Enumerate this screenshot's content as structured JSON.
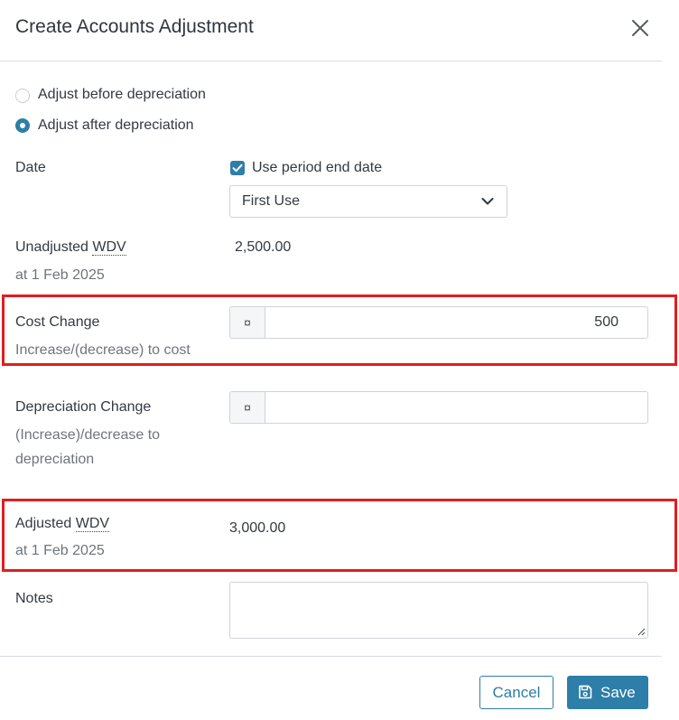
{
  "dialog": {
    "title": "Create Accounts Adjustment"
  },
  "adjust_mode": {
    "options": [
      {
        "label": "Adjust before depreciation",
        "selected": false
      },
      {
        "label": "Adjust after depreciation",
        "selected": true
      }
    ]
  },
  "date": {
    "label": "Date",
    "use_period_end_label": "Use period end date",
    "use_period_end_checked": true,
    "select_value": "First Use"
  },
  "unadjusted_wdv": {
    "label_prefix": "Unadjusted ",
    "label_abbr": "WDV",
    "sublabel": "at 1 Feb 2025",
    "value": "2,500.00"
  },
  "cost_change": {
    "label": "Cost Change",
    "sublabel": "Increase/(decrease) to cost",
    "currency_symbol": "¤",
    "value": "500"
  },
  "depreciation_change": {
    "label": "Depreciation Change",
    "sublabel_line1": "(Increase)/decrease to",
    "sublabel_line2": "depreciation",
    "currency_symbol": "¤",
    "value": ""
  },
  "adjusted_wdv": {
    "label_prefix": "Adjusted ",
    "label_abbr": "WDV",
    "sublabel": "at 1 Feb 2025",
    "value": "3,000.00"
  },
  "notes": {
    "label": "Notes",
    "value": ""
  },
  "footer": {
    "cancel_label": "Cancel",
    "save_label": "Save"
  },
  "colors": {
    "accent": "#2d7ea8",
    "highlight": "#e01e1e"
  },
  "icons": [
    "close-icon",
    "chevron-down-icon",
    "check-icon",
    "save-icon",
    "resize-grip-icon"
  ]
}
